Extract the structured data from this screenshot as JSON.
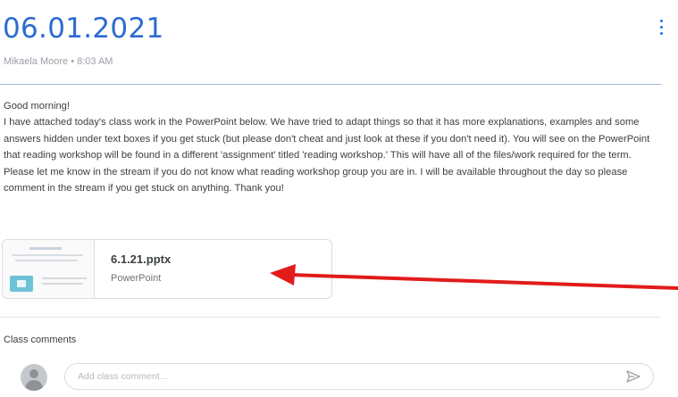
{
  "post": {
    "title": "06.01.2021",
    "meta": "Mikaela Moore • 8:03 AM",
    "body_paragraphs": [
      "Good morning!",
      "I have attached today's class work in the PowerPoint below. We have tried to adapt things so that it has more explanations, examples and some answers hidden under text boxes if you get stuck (but please don't cheat and just look at these if you don't need it). You will see on the PowerPoint that reading workshop will be found in a different 'assignment' titled 'reading workshop.' This will have all of the files/work required for the term. Please let me know in the stream if you do not know what reading workshop group you are in. I will be available throughout the day so please comment in the stream if you get stuck on anything. Thank you!"
    ]
  },
  "attachment": {
    "name": "6.1.21.pptx",
    "type": "PowerPoint"
  },
  "annotation": {
    "arrow_color": "#e21b1b"
  },
  "comments": {
    "heading": "Class comments",
    "placeholder": "Add class comment...",
    "value": ""
  },
  "colors": {
    "title": "#2e6ad1",
    "accent": "#1a73e8"
  },
  "icons": {
    "more": "more-vert-icon",
    "send": "send-icon",
    "avatar": "avatar-icon"
  }
}
